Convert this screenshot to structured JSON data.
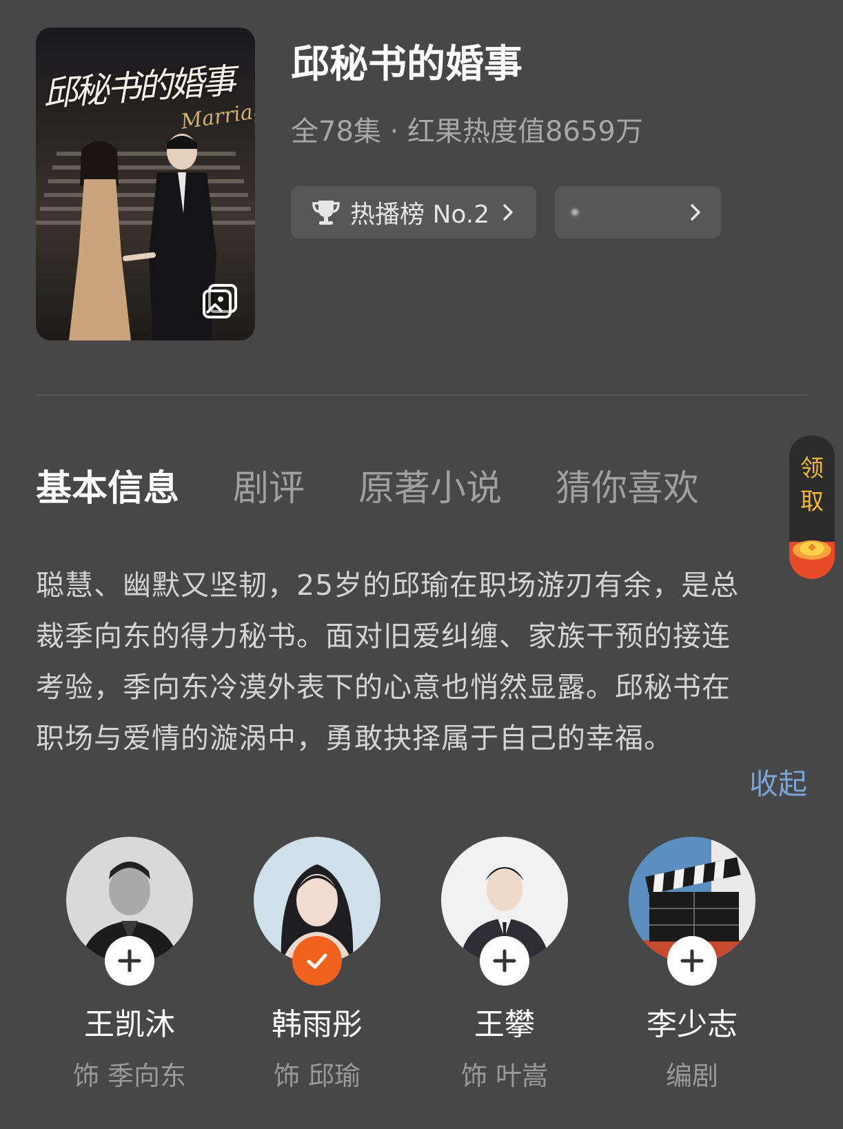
{
  "poster": {
    "calligraphy_title": "邱秘书的婚事",
    "english_title": "Marriage",
    "gallery_icon": "image-gallery-icon"
  },
  "show": {
    "title": "邱秘书的婚事",
    "meta": "全78集 · 红果热度值8659万"
  },
  "chips": {
    "ranking_label": "热播榜 No.2",
    "ranking_icon": "trophy-icon",
    "second_label": ""
  },
  "tabs": [
    {
      "label": "基本信息",
      "active": true
    },
    {
      "label": "剧评",
      "active": false
    },
    {
      "label": "原著小说",
      "active": false
    },
    {
      "label": "猜你喜欢",
      "active": false
    }
  ],
  "reward": {
    "line1": "领",
    "line2": "取",
    "icon": "red-envelope-coin-icon"
  },
  "description": {
    "lines": [
      "聪慧、幽默又坚韧，25岁的邱瑜在职场游刃有余，是总",
      "裁季向东的得力秘书。面对旧爱纠缠、家族干预的接连",
      "考验，季向东冷漠外表下的心意也悄然显露。邱秘书在",
      "职场与爱情的漩涡中，勇敢抉择属于自己的幸福。"
    ],
    "collapse_label": "收起"
  },
  "cast": [
    {
      "name": "王凯沐",
      "role": "饰 季向东",
      "followed": false
    },
    {
      "name": "韩雨彤",
      "role": "饰 邱瑜",
      "followed": true
    },
    {
      "name": "王攀",
      "role": "饰 叶嵩",
      "followed": false
    },
    {
      "name": "李少志",
      "role": "编剧",
      "followed": false
    }
  ],
  "colors": {
    "background": "#474747",
    "accent_orange": "#f2621f",
    "link_blue": "#7aa3d6",
    "reward_gold": "#f5b735"
  }
}
